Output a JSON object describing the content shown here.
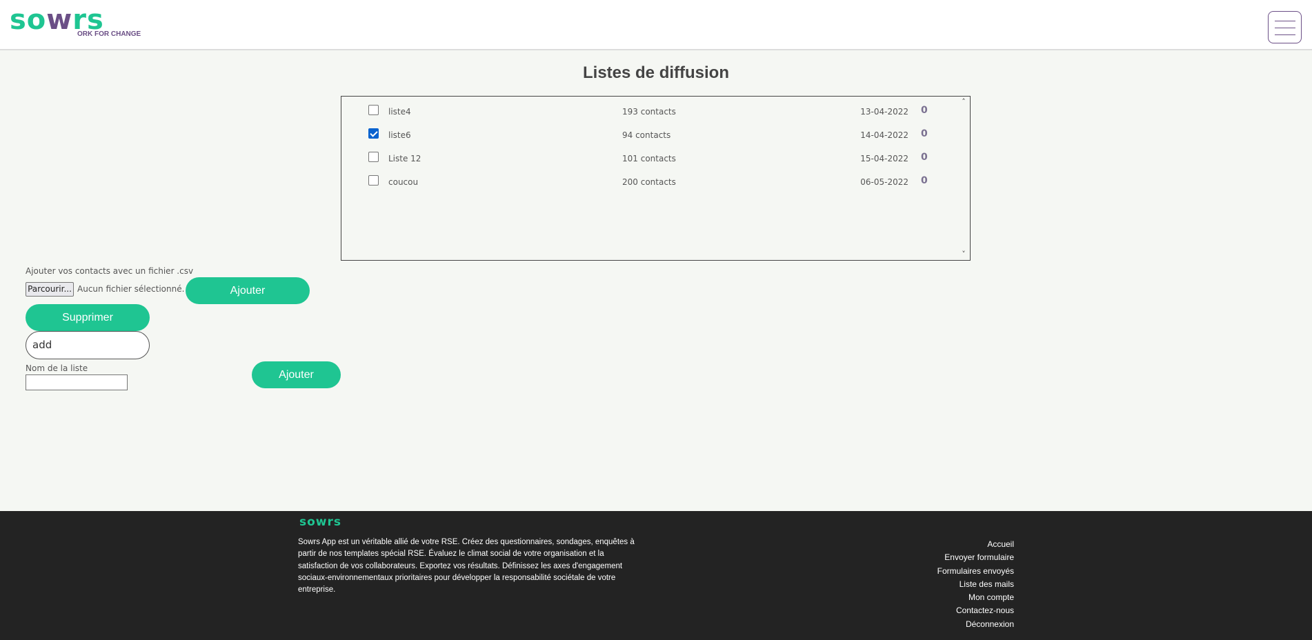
{
  "header": {
    "logo_text_left": "so",
    "logo_text_w": "w",
    "logo_text_right": "rs",
    "logo_tagline": "ORK FOR CHANGE",
    "menu_icon": "hamburger-icon"
  },
  "page": {
    "title": "Listes de diffusion"
  },
  "lists": [
    {
      "name": "liste4",
      "contacts": "193 contacts",
      "date": "13-04-2022",
      "count": "0",
      "checked": false
    },
    {
      "name": "liste6",
      "contacts": "94 contacts",
      "date": "14-04-2022",
      "count": "0",
      "checked": true
    },
    {
      "name": "Liste 12",
      "contacts": "101 contacts",
      "date": "15-04-2022",
      "count": "0",
      "checked": false
    },
    {
      "name": "coucou",
      "contacts": "200 contacts",
      "date": "06-05-2022",
      "count": "0",
      "checked": false
    }
  ],
  "form": {
    "csv_label": "Ajouter vos contacts avec un fichier .csv",
    "browse_label": "Parcourir...",
    "no_file_label": "Aucun fichier sélectionné.",
    "add_csv_label": "Ajouter",
    "delete_label": "Supprimer",
    "search_value": "add",
    "list_name_label": "Nom de la liste",
    "list_name_value": "",
    "add_list_label": "Ajouter"
  },
  "footer": {
    "logo": "sowrs",
    "description": "Sowrs App est un véritable allié de votre RSE. Créez des questionnaires, sondages, enquêtes à partir de nos templates spécial RSE. Évaluez le climat social de votre organisation et la satisfaction de vos collaborateurs. Exportez vos résultats. Définissez les axes d'engagement sociaux-environnementaux prioritaires pour développer la responsabilité sociétale de votre entreprise.",
    "links": [
      "Accueil",
      "Envoyer formulaire",
      "Formulaires envoyés",
      "Liste des mails",
      "Mon compte",
      "Contactez-nous",
      "Déconnexion"
    ]
  },
  "colors": {
    "brand_green": "#1fc592",
    "brand_purple": "#6b4f86",
    "footer_bg": "#232323",
    "checkbox_blue": "#0a63cf"
  }
}
